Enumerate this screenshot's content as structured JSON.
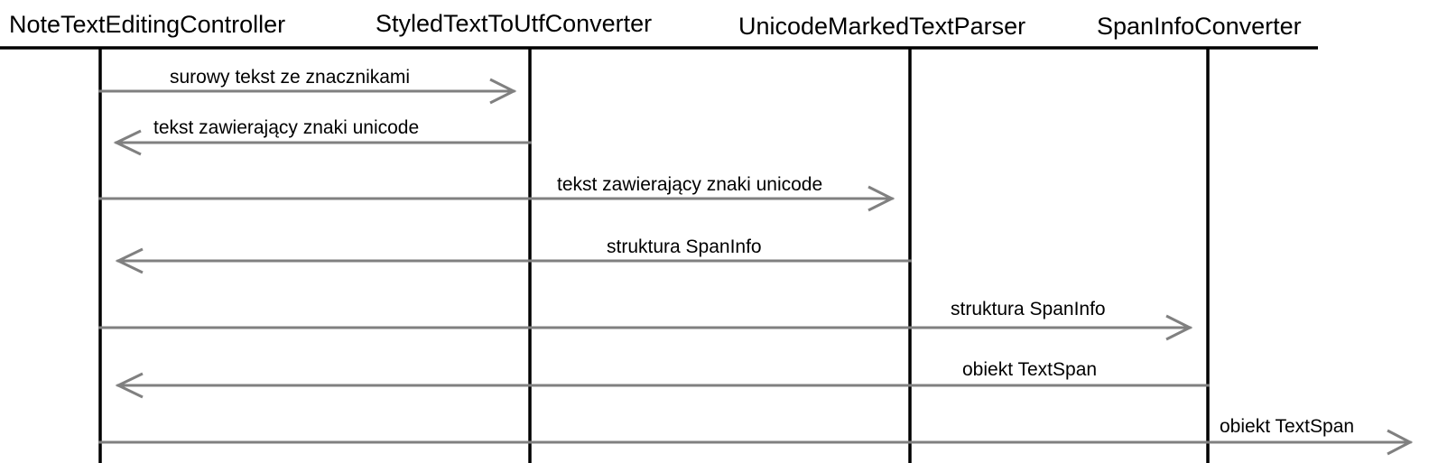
{
  "participants": [
    "NoteTextEditingController",
    "StyledTextToUtfConverter",
    "UnicodeMarkedTextParser",
    "SpanInfoConverter"
  ],
  "messages": [
    {
      "from": 0,
      "to": 1,
      "label": "surowy tekst ze znacznikami"
    },
    {
      "from": 1,
      "to": 0,
      "label": "tekst zawierający znaki unicode"
    },
    {
      "from": 0,
      "to": 2,
      "label": "tekst zawierający znaki unicode"
    },
    {
      "from": 2,
      "to": 0,
      "label": "struktura SpanInfo"
    },
    {
      "from": 0,
      "to": 3,
      "label": "struktura SpanInfo"
    },
    {
      "from": 3,
      "to": 0,
      "label": "obiekt TextSpan"
    },
    {
      "from": 0,
      "to": "out",
      "label": "obiekt TextSpan"
    }
  ],
  "colors": {
    "arrow": "#808080",
    "lifeline": "#000000"
  }
}
